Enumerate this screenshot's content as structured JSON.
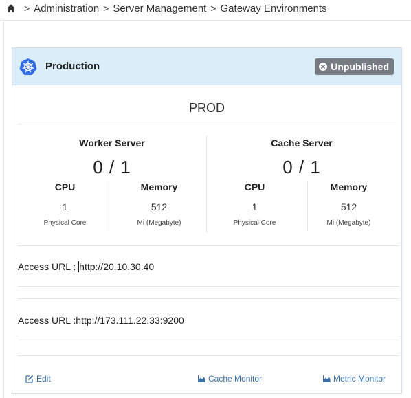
{
  "breadcrumb": {
    "items": [
      "Administration",
      "Server Management",
      "Gateway Environments"
    ],
    "separator": ">"
  },
  "card": {
    "title": "Production",
    "status_badge": "Unpublished",
    "env_name": "PROD",
    "worker": {
      "title": "Worker Server",
      "count": "0 / 1",
      "cpu_label": "CPU",
      "cpu_value": "1",
      "cpu_unit": "Physical Core",
      "mem_label": "Memory",
      "mem_value": "512",
      "mem_unit": "Mi (Megabyte)"
    },
    "cache": {
      "title": "Cache Server",
      "count": "0 / 1",
      "cpu_label": "CPU",
      "cpu_value": "1",
      "cpu_unit": "Physical Core",
      "mem_label": "Memory",
      "mem_value": "512",
      "mem_unit": "Mi (Megabyte)"
    },
    "access_urls": [
      {
        "label": "Access URL : ",
        "url": "http://20.10.30.40"
      },
      {
        "label": "Access URL :",
        "url": "http://173.111.22.33:9200"
      }
    ],
    "footer": {
      "edit": "Edit",
      "cache_monitor": "Cache Monitor",
      "metric_monitor": "Metric Monitor"
    }
  },
  "colors": {
    "header_bg": "#dcedfa",
    "k8s_blue": "#326ce5",
    "badge_bg": "#767c82",
    "link": "#3a6ea5"
  }
}
